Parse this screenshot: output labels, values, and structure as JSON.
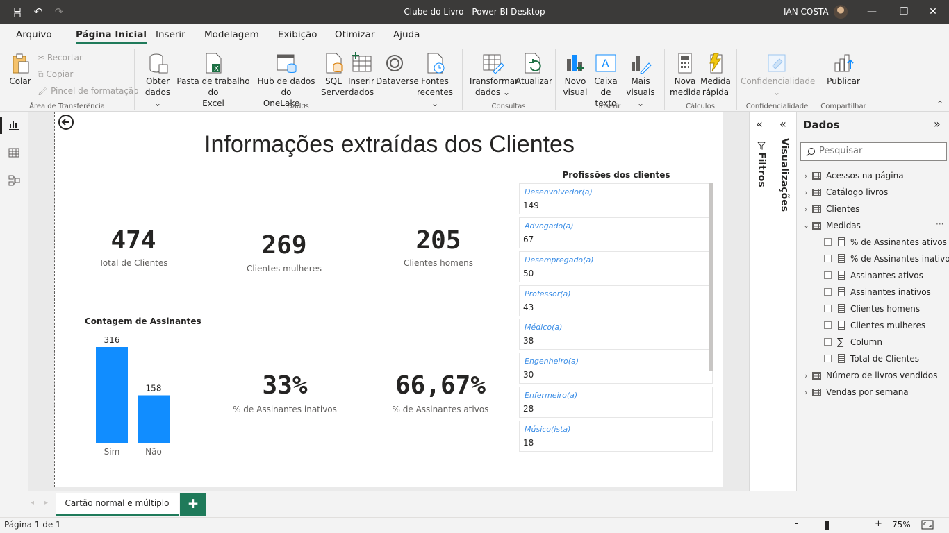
{
  "window": {
    "title": "Clube do Livro - Power BI Desktop",
    "user": "IAN COSTA"
  },
  "menu": {
    "items": [
      "Arquivo",
      "Página Inicial",
      "Inserir",
      "Modelagem",
      "Exibição",
      "Otimizar",
      "Ajuda"
    ],
    "active": "Página Inicial"
  },
  "ribbon": {
    "colar": "Colar",
    "recortar": "Recortar",
    "copiar": "Copiar",
    "pincel": "Pincel de formatação",
    "grp_transferencia": "Área de Transferência",
    "obter_dados_1": "Obter",
    "obter_dados_2": "dados",
    "pasta_1": "Pasta de trabalho do",
    "pasta_2": "Excel",
    "hub_1": "Hub de dados do",
    "hub_2": "OneLake",
    "sql_1": "SQL",
    "sql_2": "Server",
    "inserir_dados_1": "Inserir",
    "inserir_dados_2": "dados",
    "dataverse": "Dataverse",
    "fontes_1": "Fontes",
    "fontes_2": "recentes",
    "grp_dados": "Dados",
    "transformar_1": "Transformar",
    "transformar_2": "dados",
    "atualizar": "Atualizar",
    "grp_consultas": "Consultas",
    "novo_visual_1": "Novo",
    "novo_visual_2": "visual",
    "caixa_1": "Caixa de",
    "caixa_2": "texto",
    "mais_1": "Mais",
    "mais_2": "visuais",
    "grp_inserir": "Inserir",
    "nova_medida_1": "Nova",
    "nova_medida_2": "medida",
    "medida_rapida_1": "Medida",
    "medida_rapida_2": "rápida",
    "grp_calculos": "Cálculos",
    "confidencialidade": "Confidencialidade",
    "grp_confidencialidade": "Confidencialidade",
    "publicar": "Publicar",
    "grp_compartilhar": "Compartilhar"
  },
  "report": {
    "title": "Informações extraídas dos Clientes",
    "cards": [
      {
        "value": "474",
        "label": "Total de Clientes"
      },
      {
        "value": "269",
        "label": "Clientes mulheres"
      },
      {
        "value": "205",
        "label": "Clientes homens"
      },
      {
        "value": "33%",
        "label": "% de Assinantes inativos"
      },
      {
        "value": "66,67%",
        "label": "% de Assinantes ativos"
      }
    ],
    "professions_title": "Profissões dos clientes",
    "professions": [
      {
        "name": "Desenvolvedor(a)",
        "count": "149"
      },
      {
        "name": "Advogado(a)",
        "count": "67"
      },
      {
        "name": "Desempregado(a)",
        "count": "50"
      },
      {
        "name": "Professor(a)",
        "count": "43"
      },
      {
        "name": "Médico(a)",
        "count": "38"
      },
      {
        "name": "Engenheiro(a)",
        "count": "30"
      },
      {
        "name": "Enfermeiro(a)",
        "count": "28"
      },
      {
        "name": "Músico(ista)",
        "count": "18"
      }
    ]
  },
  "chart_data": {
    "type": "bar",
    "title": "Contagem de Assinantes",
    "categories": [
      "Sim",
      "Não"
    ],
    "values": [
      316,
      158
    ],
    "data_labels": [
      "316",
      "158"
    ],
    "bar_color": "#118dff",
    "ylim": [
      0,
      316
    ]
  },
  "panes": {
    "filtros": "Filtros",
    "visualizacoes": "Visualizações",
    "dados": "Dados",
    "search_placeholder": "Pesquisar"
  },
  "fields": {
    "tables": [
      "Acessos na página",
      "Catálogo livros",
      "Clientes",
      "Medidas",
      "Número de livros vendidos",
      "Vendas por semana"
    ],
    "measures": [
      "% de Assinantes ativos",
      "% de Assinantes inativos",
      "Assinantes ativos",
      "Assinantes inativos",
      "Clientes homens",
      "Clientes mulheres",
      "Column",
      "Total de Clientes"
    ],
    "more": "···"
  },
  "tabs": {
    "page": "Cartão normal e múltiplo",
    "add": "+"
  },
  "status": {
    "page": "Página 1 de 1",
    "zoom": "75%",
    "minus": "-",
    "plus": "+"
  },
  "colors": {
    "accent": "#118dff",
    "active_tab": "#1f7a5a",
    "link": "#3c8ee6"
  }
}
